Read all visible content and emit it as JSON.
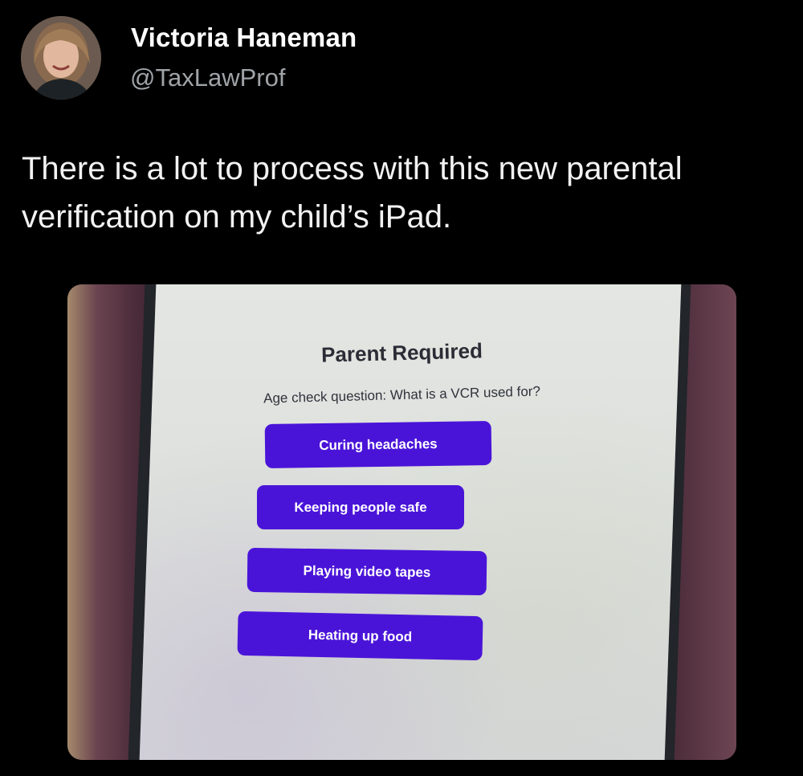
{
  "tweet": {
    "author": {
      "name": "Victoria Haneman",
      "handle": "@TaxLawProf"
    },
    "text": "There is a lot to process with this new parental verification on my child’s iPad.",
    "photo": {
      "screen": {
        "title": "Parent Required",
        "question": "Age check question: What is a VCR used for?",
        "answers": [
          "Curing headaches",
          "Keeping people safe",
          "Playing video tapes",
          "Heating up food"
        ],
        "answer_color": "#4a14d8"
      }
    }
  }
}
